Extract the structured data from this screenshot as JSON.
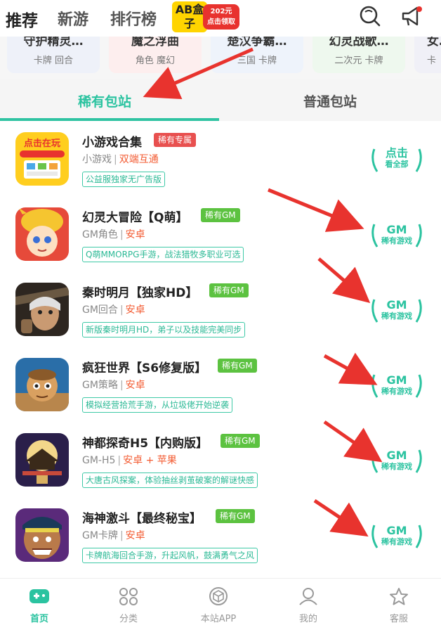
{
  "header": {
    "tabs": [
      "推荐",
      "新游",
      "排行榜"
    ],
    "promo": {
      "logo_text": "AB盒子",
      "amount": "202元",
      "cta": "点击领取"
    },
    "icons": [
      "search-icon",
      "megaphone-icon"
    ]
  },
  "categories": [
    {
      "title": "守护精灵…",
      "sub": "卡牌 回合",
      "bg": "#eef1f9"
    },
    {
      "title": "魔之浮曲",
      "sub": "角色 魔幻",
      "bg": "#fdeeee"
    },
    {
      "title": "楚汉争霸…",
      "sub": "三国 卡牌",
      "bg": "#eef3fb"
    },
    {
      "title": "幻灵战歌…",
      "sub": "二次元 卡牌",
      "bg": "#eef8ee"
    },
    {
      "title": "女…",
      "sub": "卡",
      "bg": "#f0f0f7"
    }
  ],
  "pkg_tabs": [
    "稀有包站",
    "普通包站"
  ],
  "games": [
    {
      "name": "小游戏合集",
      "tag": "稀有专属",
      "tag_color": "red",
      "genre": "小游戏",
      "platform": "双端互通",
      "desc": "公益服独家无广告版",
      "badge1": "点击",
      "badge2": "看全部"
    },
    {
      "name": "幻灵大冒险【Q萌】",
      "tag": "稀有GM",
      "tag_color": "green",
      "genre": "GM角色",
      "platform": "安卓",
      "desc": "Q萌MMORPG手游，战法猎牧多职业可选",
      "badge1": "GM",
      "badge2": "稀有游戏"
    },
    {
      "name": "秦时明月【独家HD】",
      "tag": "稀有GM",
      "tag_color": "green",
      "genre": "GM回合",
      "platform": "安卓",
      "desc": "新版秦时明月HD，弟子以及技能完美同步",
      "badge1": "GM",
      "badge2": "稀有游戏"
    },
    {
      "name": "疯狂世界【S6修复版】",
      "tag": "稀有GM",
      "tag_color": "green",
      "genre": "GM策略",
      "platform": "安卓",
      "desc": "模拟经营拾荒手游，从垃圾佬开始逆袭",
      "badge1": "GM",
      "badge2": "稀有游戏"
    },
    {
      "name": "神都探奇H5【内购版】",
      "tag": "稀有GM",
      "tag_color": "green",
      "genre": "GM-H5",
      "platform": "安卓 + 苹果",
      "desc": "大唐古风探案，体验抽丝剥茧破案的解谜快感",
      "badge1": "GM",
      "badge2": "稀有游戏"
    },
    {
      "name": "海神激斗【最终秘宝】",
      "tag": "稀有GM",
      "tag_color": "green",
      "genre": "GM卡牌",
      "platform": "安卓",
      "desc": "卡牌航海回合手游，升起风帆，鼓满勇气之风",
      "badge1": "GM",
      "badge2": "稀有游戏"
    }
  ],
  "bottom_nav": [
    "首页",
    "分类",
    "本站APP",
    "我的",
    "客服"
  ],
  "colors": {
    "accent": "#2bc3a0",
    "platform": "#f35b32",
    "tag_red": "#e8504f",
    "tag_green": "#5cc240",
    "arrow": "#e8332e"
  }
}
